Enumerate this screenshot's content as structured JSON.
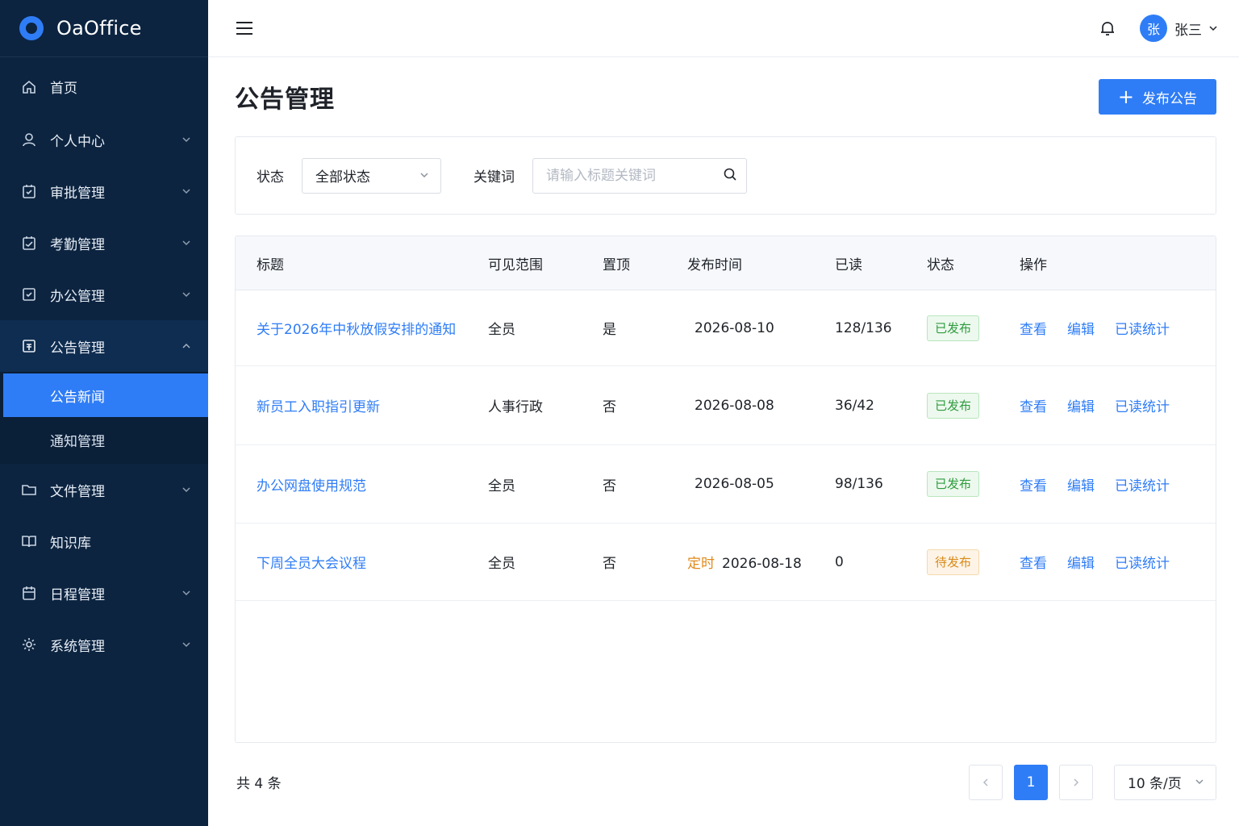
{
  "brand": {
    "name": "OaOffice",
    "accent": "#2f7df6",
    "sidebar_bg": "#0c2440"
  },
  "sidebar": {
    "items": [
      {
        "label": "首页",
        "icon": "home-icon"
      },
      {
        "label": "个人中心",
        "icon": "user-icon"
      },
      {
        "label": "审批管理",
        "icon": "approval-icon"
      },
      {
        "label": "考勤管理",
        "icon": "attendance-icon"
      },
      {
        "label": "办公管理",
        "icon": "office-icon"
      },
      {
        "label": "公告管理",
        "icon": "announcement-icon"
      },
      {
        "label": "文件管理",
        "icon": "folder-icon"
      },
      {
        "label": "知识库",
        "icon": "book-icon"
      },
      {
        "label": "日程管理",
        "icon": "calendar-icon"
      },
      {
        "label": "系统管理",
        "icon": "gear-icon"
      }
    ],
    "sub_items": [
      {
        "label": "公告新闻",
        "active": true
      },
      {
        "label": "通知管理",
        "active": false
      }
    ]
  },
  "header": {
    "user_avatar": "张",
    "user_name": "张三"
  },
  "page": {
    "title": "公告管理",
    "publish_button": "发布公告"
  },
  "filters": {
    "status_label": "状态",
    "status_value": "全部状态",
    "keyword_label": "关键词",
    "keyword_placeholder": "请输入标题关键词"
  },
  "table": {
    "columns": [
      "标题",
      "可见范围",
      "置顶",
      "发布时间",
      "已读",
      "状态",
      "操作"
    ],
    "rows": [
      {
        "title": "关于2026年中秋放假安排的通知",
        "scope": "全员",
        "pinned": "是",
        "time_prefix": "",
        "time": "2026-08-10",
        "read": "128/136",
        "status": "已发布",
        "status_type": "published"
      },
      {
        "title": "新员工入职指引更新",
        "scope": "人事行政",
        "pinned": "否",
        "time_prefix": "",
        "time": "2026-08-08",
        "read": "36/42",
        "status": "已发布",
        "status_type": "published"
      },
      {
        "title": "办公网盘使用规范",
        "scope": "全员",
        "pinned": "否",
        "time_prefix": "",
        "time": "2026-08-05",
        "read": "98/136",
        "status": "已发布",
        "status_type": "published"
      },
      {
        "title": "下周全员大会议程",
        "scope": "全员",
        "pinned": "否",
        "time_prefix": "定时",
        "time": "2026-08-18",
        "read": "0",
        "status": "待发布",
        "status_type": "pending"
      }
    ],
    "actions": [
      "查看",
      "编辑",
      "已读统计"
    ]
  },
  "pagination": {
    "total_text": "共 4 条",
    "current_page": "1",
    "page_size": "10 条/页"
  }
}
